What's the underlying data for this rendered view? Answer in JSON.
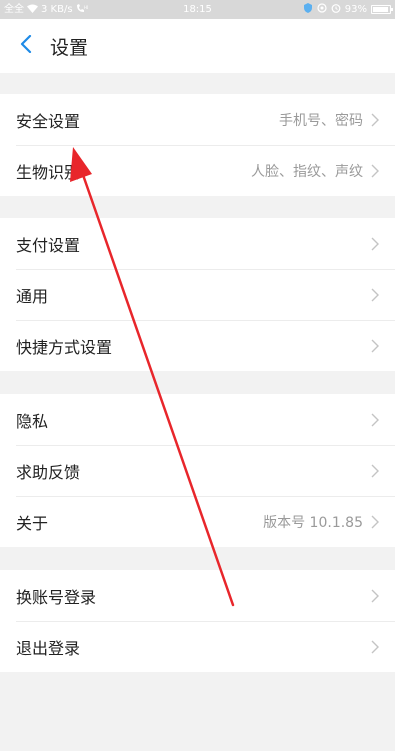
{
  "status_bar": {
    "signal": "全全",
    "wifi_icon": "wifi-icon",
    "speed": "3 KB/s",
    "time": "18:15",
    "battery_percent": "93%",
    "battery_level": 0.93
  },
  "header": {
    "back_icon": "chevron-left-icon",
    "title": "设置"
  },
  "groups": [
    {
      "items": [
        {
          "label": "安全设置",
          "value": "手机号、密码"
        },
        {
          "label": "生物识别",
          "value": "人脸、指纹、声纹"
        }
      ]
    },
    {
      "items": [
        {
          "label": "支付设置"
        },
        {
          "label": "通用"
        },
        {
          "label": "快捷方式设置"
        }
      ]
    },
    {
      "items": [
        {
          "label": "隐私"
        },
        {
          "label": "求助反馈"
        },
        {
          "label": "关于",
          "value": "版本号 10.1.85"
        }
      ]
    },
    {
      "items": [
        {
          "label": "换账号登录"
        },
        {
          "label": "退出登录"
        }
      ]
    }
  ],
  "colors": {
    "accent": "#1e8ae6",
    "annotation_arrow": "#e8262b",
    "background": "#f2f2f2",
    "secondary_text": "#9a9a9a"
  }
}
